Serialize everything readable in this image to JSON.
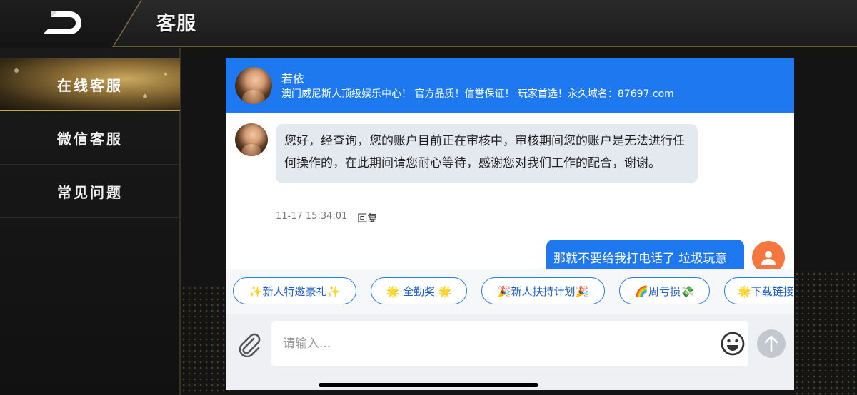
{
  "header": {
    "title": "客服"
  },
  "sidebar": {
    "items": [
      {
        "label": "在线客服",
        "active": true
      },
      {
        "label": "微信客服",
        "active": false
      },
      {
        "label": "常见问题",
        "active": false
      }
    ]
  },
  "chat": {
    "agent": {
      "name": "若依",
      "slogan": "澳门威尼斯人顶级娱乐中心！ 官方品质！信誉保证！ 玩家首选！永久域名：87697.com"
    },
    "messages": [
      {
        "from": "agent",
        "text": "您好，经查询，您的账户目前正在审核中，审核期间您的账户是无法进行任何操作的，在此期间请您耐心等待，感谢您对我们工作的配合，谢谢。",
        "time": "11-17 15:34:01",
        "reply_label": "回复"
      },
      {
        "from": "user",
        "text": "那就不要给我打电话了 垃圾玩意"
      }
    ],
    "quick_replies": [
      "✨新人特邀豪礼✨",
      "🌟 全勤奖 🌟",
      "🎉新人扶持计划🎉",
      "🌈周亏损💸",
      "🌟下载链接"
    ],
    "input": {
      "placeholder": "请输入..."
    }
  },
  "colors": {
    "accent_blue": "#1e78f0",
    "gold": "#c5a35a",
    "user_avatar": "#f3773f"
  },
  "icons": [
    "logo",
    "attach-icon",
    "emoji-icon",
    "send-arrow-icon",
    "user-icon"
  ]
}
